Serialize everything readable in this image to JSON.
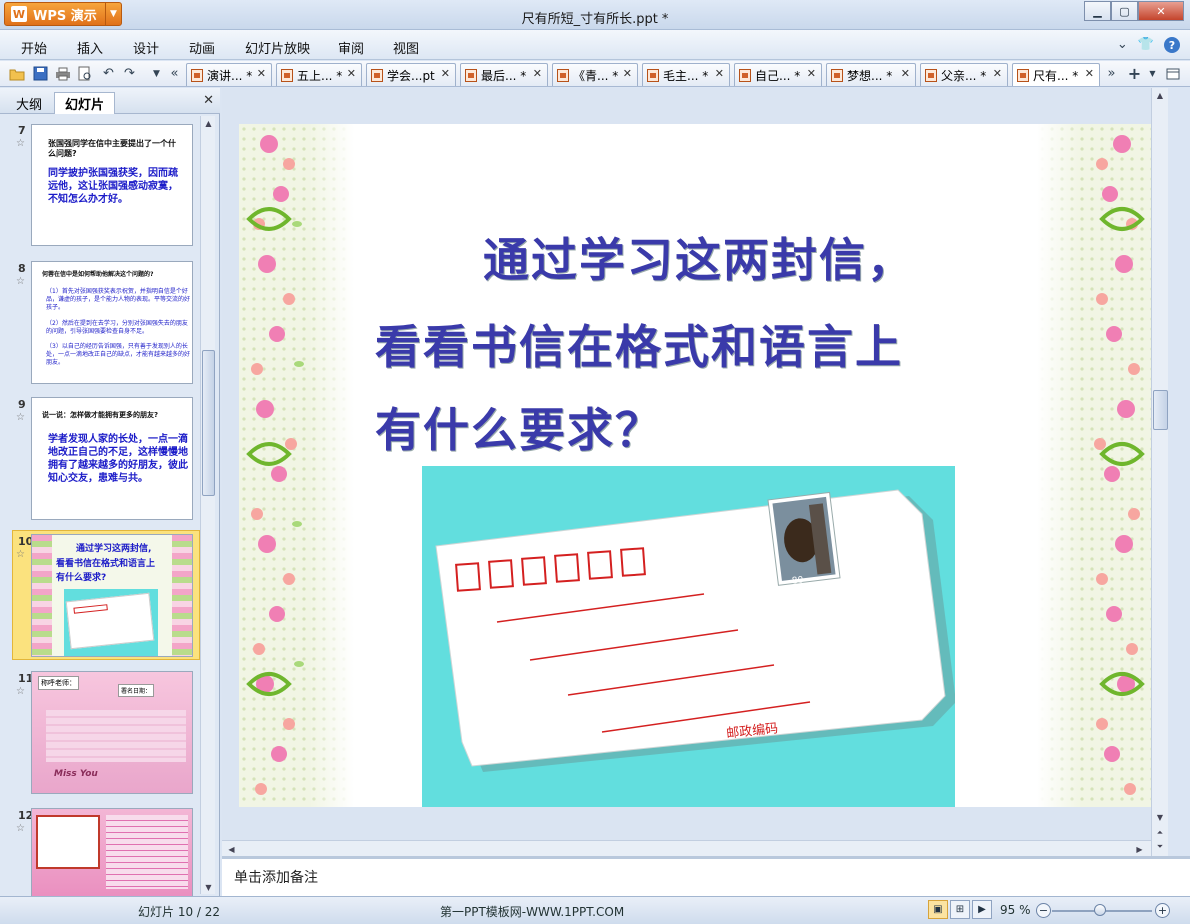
{
  "app": {
    "badge": "WPS 演示",
    "logo_letter": "W"
  },
  "window": {
    "title": "尺有所短_寸有所长.ppt *",
    "min": "▁",
    "max": "▢",
    "close": "✕"
  },
  "menu": {
    "items": [
      "开始",
      "插入",
      "设计",
      "动画",
      "幻灯片放映",
      "审阅",
      "视图"
    ],
    "right": {
      "expand": "⌄",
      "skin": "👕",
      "help": "?"
    }
  },
  "toolbar": {
    "icons": [
      "open-icon",
      "save-icon",
      "print-icon",
      "print-preview-icon",
      "undo-icon",
      "redo-icon",
      "customize-icon"
    ]
  },
  "doc_tabs": [
    {
      "label": "演讲... *",
      "active": false
    },
    {
      "label": "五上... *",
      "active": false
    },
    {
      "label": "学会...pt",
      "active": false
    },
    {
      "label": "最后... *",
      "active": false
    },
    {
      "label": "《青... *",
      "active": false
    },
    {
      "label": "毛主... *",
      "active": false
    },
    {
      "label": "自己... *",
      "active": false
    },
    {
      "label": "梦想... *",
      "active": false
    },
    {
      "label": "父亲... *",
      "active": false
    },
    {
      "label": "尺有... *",
      "active": true
    }
  ],
  "left_panel": {
    "tabs": [
      "大纲",
      "幻灯片"
    ],
    "active_tab": "幻灯片",
    "close": "✕",
    "slides": [
      {
        "number": "7",
        "question": "张国强同学在信中主要提出了一个什么问题?",
        "answer": "同学披护张国强获奖，因而疏远他，这让张国强感动寂寞，不知怎么办才好。"
      },
      {
        "number": "8",
        "question": "何蓉在信中是如何帮助他解决这个问题的?",
        "small": [
          "（1）首先对张国强获奖表示祝贺，并指明自信是个好品，谦虚的孩子，是个能力人物的表现。平等交流的好孩子。",
          "（2）然后在提到在去学习，分别对张国强失去的朋友的问题，引导张国强要检查自身不足。",
          "（3）以自己的经历告诉国强，只有善于发现别人的长处，一点一滴地改正自己的缺点，才能有越来越多的好朋友。"
        ]
      },
      {
        "number": "9",
        "question": "说一说：怎样做才能拥有更多的朋友?",
        "answer": "学者发现人家的长处，一点一滴地改正自己的不足，这样慢慢地拥有了越来越多的好朋友，彼此知心交友，患难与共。"
      },
      {
        "number": "10",
        "line1": "通过学习这两封信,",
        "line2": "看看书信在格式和语言上",
        "line3": "有什么要求?"
      },
      {
        "number": "11",
        "label_a": "称呼老师：",
        "label_b": "署名日期：",
        "miss": "Miss You"
      },
      {
        "number": "12"
      }
    ]
  },
  "slide": {
    "line1": "通过学习这两封信，",
    "line2": "看看书信在格式和语言上",
    "line3": "有什么要求？",
    "postcode_label": "邮政编码",
    "stamp_value": "80"
  },
  "notes": {
    "placeholder": "单击添加备注"
  },
  "status": {
    "slide_counter": "幻灯片 10 / 22",
    "template": "第一PPT模板网-WWW.1PPT.COM",
    "zoom": "95 %",
    "zoom_out": "−",
    "zoom_in": "+"
  },
  "colors": {
    "slide_title": "#3a3aaa",
    "envelope_bg": "#62dede",
    "postcode_red": "#d42020",
    "thumb_text_blue": "#1b1bc8"
  }
}
